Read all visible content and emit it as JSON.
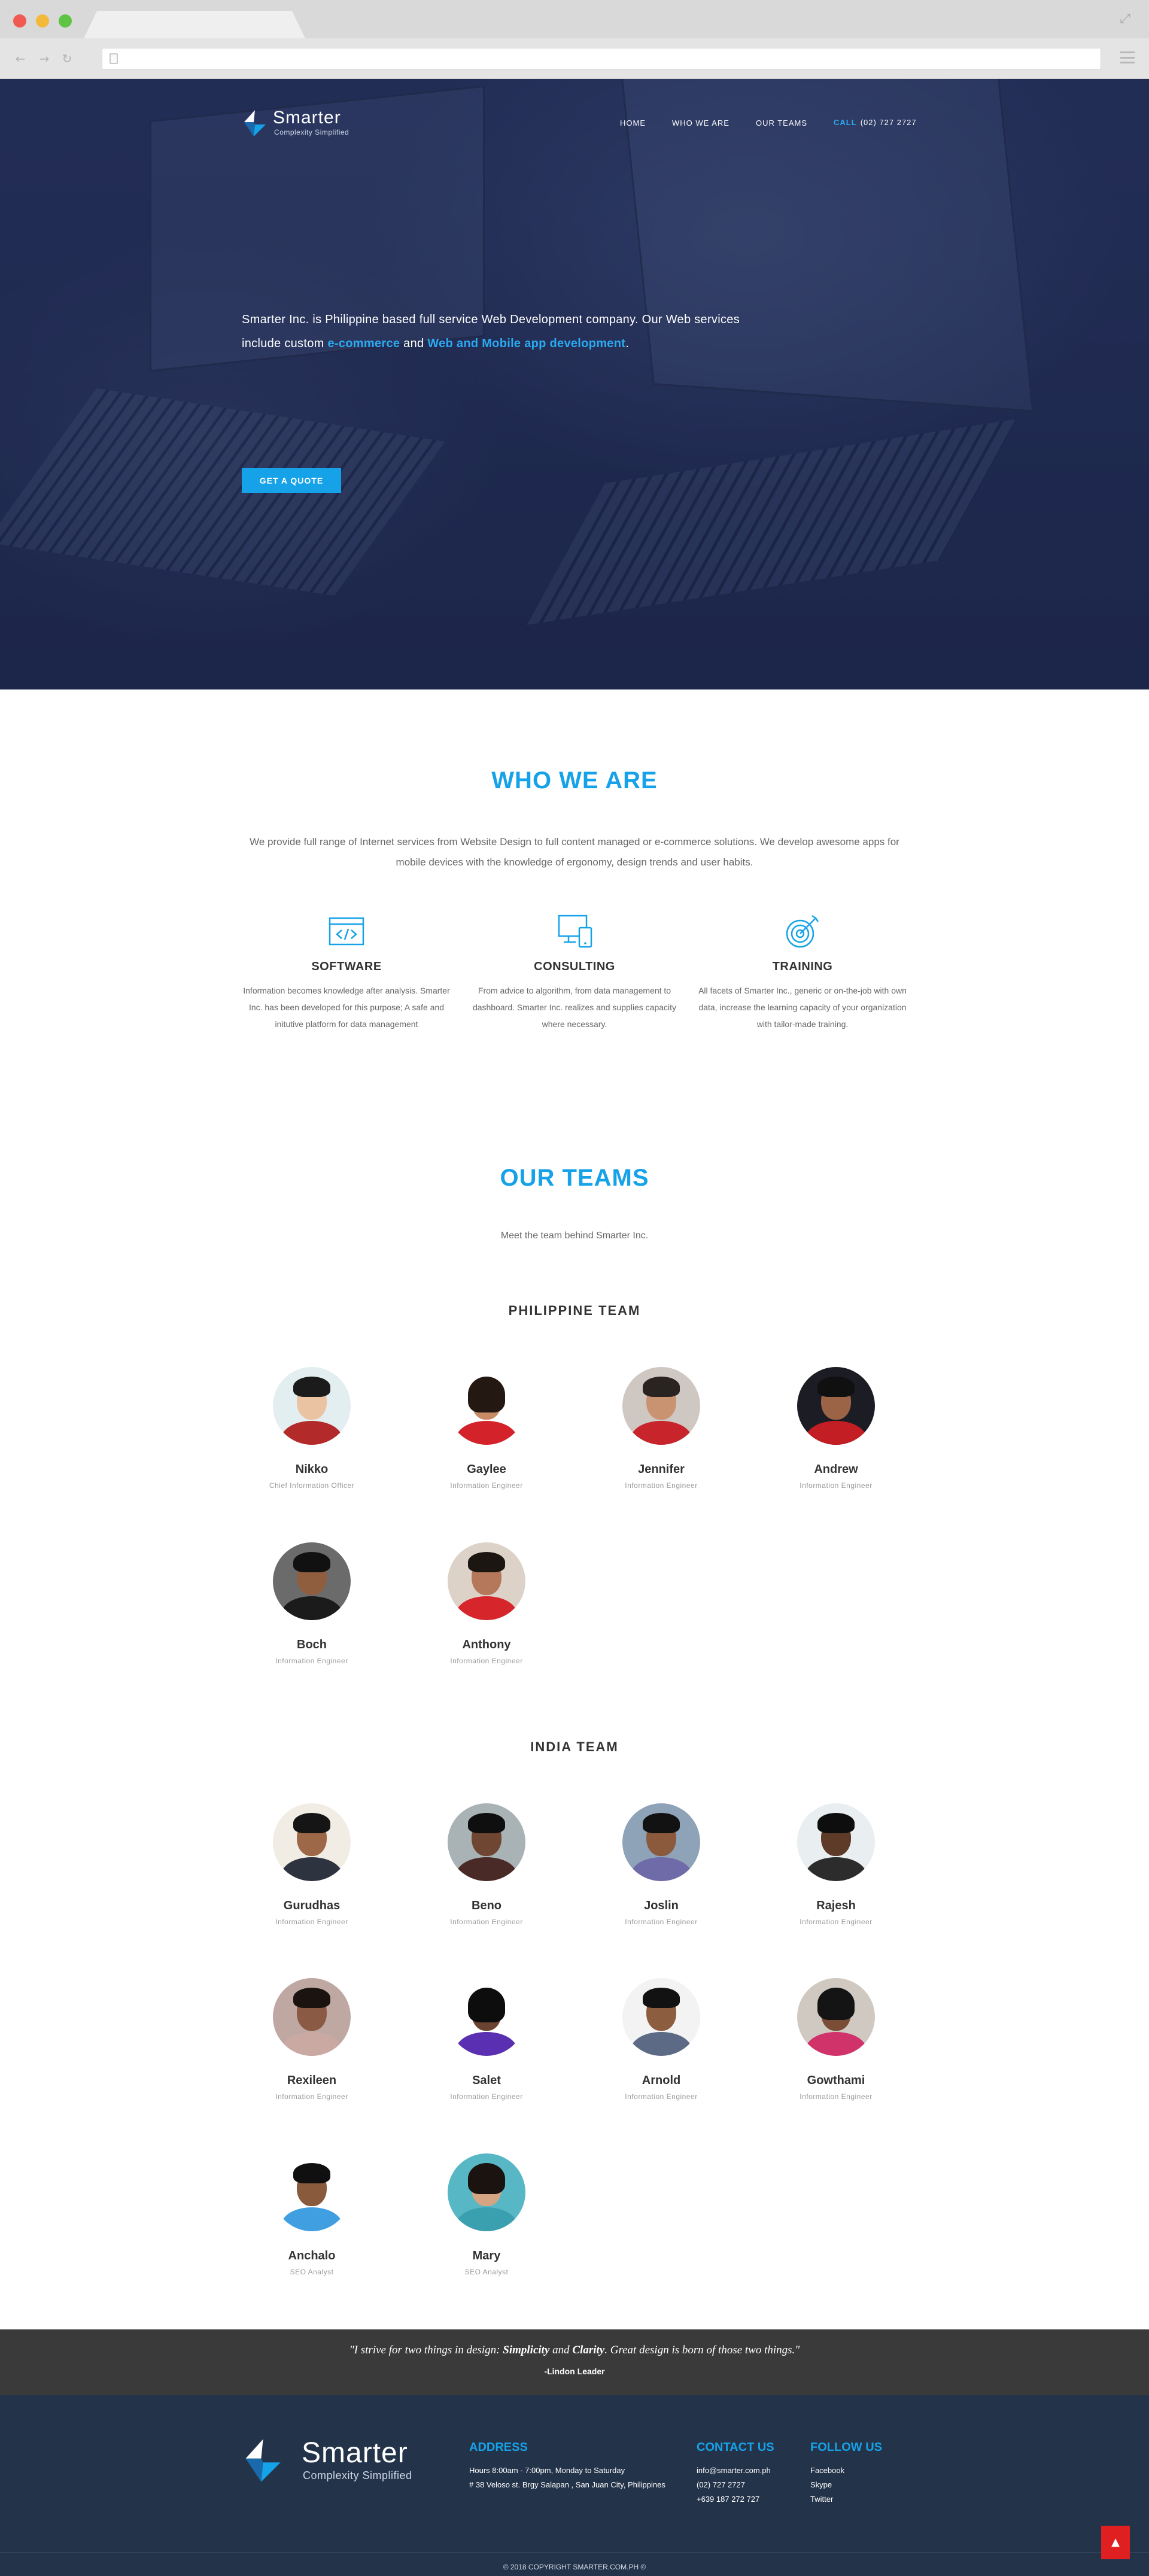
{
  "colors": {
    "accent": "#16a2e8",
    "hero_bg": "#232d55",
    "footer_bg": "#23334a",
    "quote_bg": "#3a3a3a",
    "back_to_top": "#e02020"
  },
  "browser": {
    "icons": [
      "back-arrow-icon",
      "forward-arrow-icon",
      "reload-icon",
      "page-icon",
      "menu-icon",
      "expand-icon"
    ]
  },
  "header": {
    "logo_word": "Smarter",
    "logo_tagline": "Complexity Simplified",
    "nav": [
      "HOME",
      "WHO WE ARE",
      "OUR TEAMS"
    ],
    "call_label": "CALL",
    "call_number": "(02) 727 2727"
  },
  "hero": {
    "text_before": "Smarter Inc. is Philippine based full service Web Development company. Our Web services include custom ",
    "highlight_1": "e-commerce",
    "text_and": " and ",
    "highlight_2": "Web and Mobile app development",
    "text_end": ".",
    "button": "GET A QUOTE"
  },
  "who": {
    "title": "WHO WE ARE",
    "intro": "We provide full range of Internet services from Website Design to full content managed or e-commerce solutions. We develop awesome apps for mobile devices with the knowledge of ergonomy, design trends and user habits.",
    "services": [
      {
        "icon": "code-window-icon",
        "title": "SOFTWARE",
        "text": "Information becomes knowledge after analysis. Smarter Inc. has been developed for this purpose; A safe and initutive platform for data management"
      },
      {
        "icon": "devices-icon",
        "title": "CONSULTING",
        "text": "From advice to algorithm, from data management to dashboard. Smarter Inc. realizes and supplies capacity where necessary."
      },
      {
        "icon": "target-icon",
        "title": "TRAINING",
        "text": "All facets of Smarter Inc., generic or on-the-job with own data, increase the learning capacity of your organization with tailor-made training."
      }
    ]
  },
  "teams": {
    "title": "OUR TEAMS",
    "subtitle": "Meet the team behind Smarter Inc.",
    "philippine_title": "PHILIPPINE TEAM",
    "philippine": [
      {
        "name": "Nikko",
        "role": "Chief Information Officer"
      },
      {
        "name": "Gaylee",
        "role": "Information Engineer"
      },
      {
        "name": "Jennifer",
        "role": "Information Engineer"
      },
      {
        "name": "Andrew",
        "role": "Information Engineer"
      },
      {
        "name": "Boch",
        "role": "Information Engineer"
      },
      {
        "name": "Anthony",
        "role": "Information Engineer"
      }
    ],
    "india_title": "INDIA TEAM",
    "india": [
      {
        "name": "Gurudhas",
        "role": "Information Engineer"
      },
      {
        "name": "Beno",
        "role": "Information Engineer"
      },
      {
        "name": "Joslin",
        "role": "Information Engineer"
      },
      {
        "name": "Rajesh",
        "role": "Information Engineer"
      },
      {
        "name": "Rexileen",
        "role": "Information Engineer"
      },
      {
        "name": "Salet",
        "role": "Information Engineer"
      },
      {
        "name": "Arnold",
        "role": "Information Engineer"
      },
      {
        "name": "Gowthami",
        "role": "Information Engineer"
      },
      {
        "name": "Anchalo",
        "role": "SEO Analyst"
      },
      {
        "name": "Mary",
        "role": "SEO Analyst"
      }
    ]
  },
  "quote": {
    "part1": "\"I strive for two things in design: ",
    "bold1": "Simplicity",
    "part2": " and ",
    "bold2": "Clarity",
    "part3": ". Great design is born of those two things.\"",
    "author": "-Lindon Leader"
  },
  "footer": {
    "logo_word": "Smarter",
    "logo_tagline": "Complexity Simplified",
    "address_title": "ADDRESS",
    "address_hours": "Hours 8:00am - 7:00pm, Monday to Saturday",
    "address_line": "# 38 Veloso st. Brgy Salapan , San Juan City, Philippines",
    "contact_title": "CONTACT US",
    "contact_email": "info@smarter.com.ph",
    "contact_phone": "(02) 727 2727",
    "contact_mobile": "+639 187 272 727",
    "follow_title": "FOLLOW US",
    "follow_links": [
      "Facebook",
      "Skype",
      "Twitter"
    ],
    "copyright": "© 2018 COPYRIGHT SMARTER.COM.PH ©",
    "back_to_top": "▲"
  }
}
